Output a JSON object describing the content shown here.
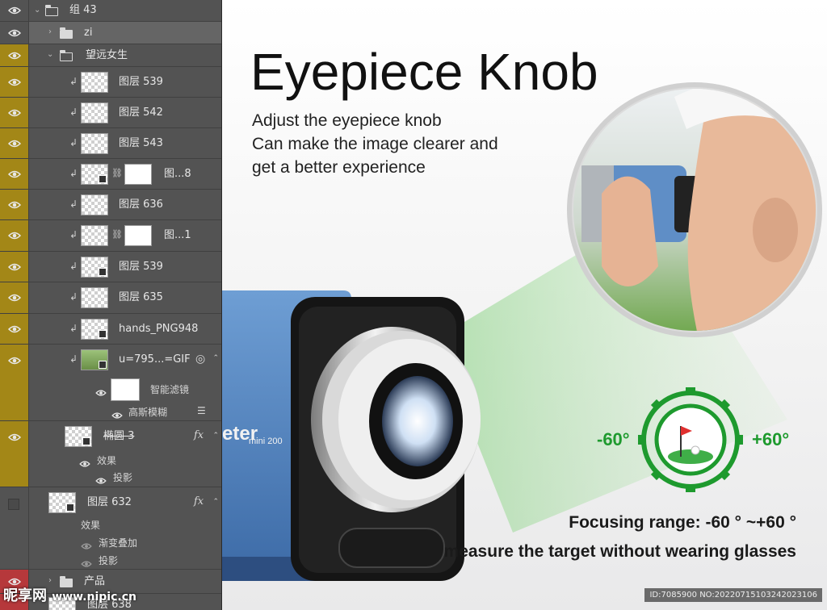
{
  "layers_panel": {
    "rows": [
      {
        "label": "组 43",
        "kind": "group-open"
      },
      {
        "label": "zi",
        "kind": "group-closed"
      },
      {
        "label": "望远女生",
        "kind": "group-open"
      },
      {
        "label": "图层 539"
      },
      {
        "label": "图层 542"
      },
      {
        "label": "图层 543"
      },
      {
        "label": "图...8"
      },
      {
        "label": "图层 636"
      },
      {
        "label": "图...1"
      },
      {
        "label": "图层 539"
      },
      {
        "label": "图层 635"
      },
      {
        "label": "hands_PNG948"
      },
      {
        "label": "u=795...=GIF"
      },
      {
        "label": "智能滤镜"
      },
      {
        "label": "高斯模糊"
      },
      {
        "label": "椭圆 3"
      },
      {
        "label": "效果"
      },
      {
        "label": "投影"
      },
      {
        "label": "图层 632"
      },
      {
        "label": "效果"
      },
      {
        "label": "渐变叠加"
      },
      {
        "label": "投影"
      },
      {
        "label": "产品"
      },
      {
        "label": "图层 638"
      }
    ],
    "fx_label": "fx",
    "accent_color": "#a38717",
    "red_color": "#b6383b"
  },
  "canvas": {
    "title": "Eyepiece Knob",
    "desc_lines": [
      "Adjust the eyepiece knob",
      "Can make the image clearer and",
      "get a better experience"
    ],
    "brand_text": "eter",
    "brand_sub": "mini 200",
    "deg_left": "-60°",
    "deg_right": "+60°",
    "focus_text": "Focusing range: -60 ° ~+60 °",
    "measure_text": "measure the target without wearing glasses",
    "accent_green": "#1e9a2e"
  },
  "watermark": {
    "logo": "昵享网",
    "url": "www.nipic.cn",
    "id_text": "ID:7085900 NO:20220715103242023106"
  }
}
